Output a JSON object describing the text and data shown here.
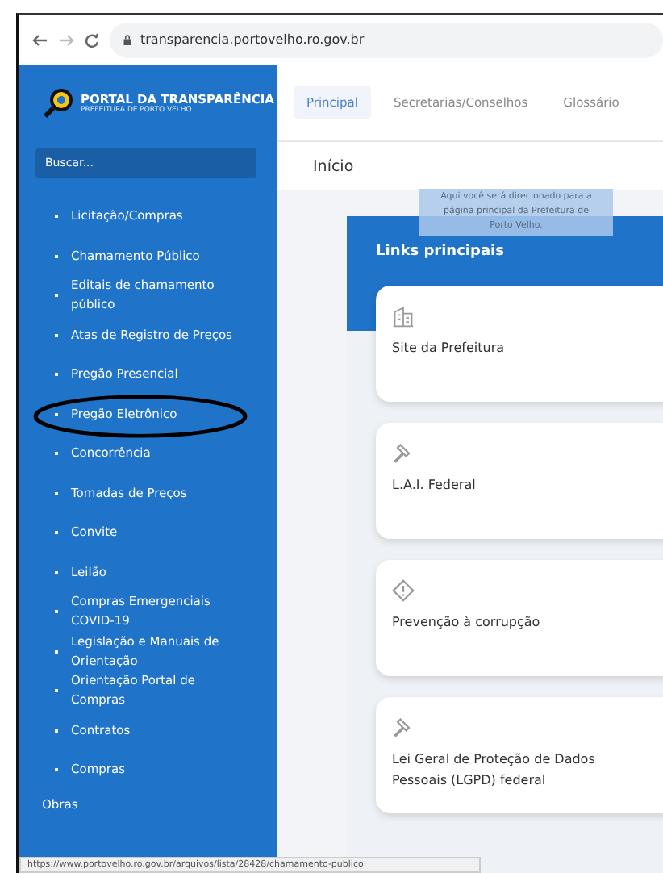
{
  "browser": {
    "url": "transparencia.portovelho.ro.gov.br"
  },
  "brand": {
    "title": "PORTAL DA TRANSPARÊNCIA",
    "subtitle": "PREFEITURA DE PORTO VELHO"
  },
  "search": {
    "placeholder": "Buscar..."
  },
  "sidebar": {
    "items": [
      {
        "label": "Licitação/Compras",
        "circled": false
      },
      {
        "label": "Chamamento Público",
        "circled": false
      },
      {
        "label": "Editais de chamamento público",
        "circled": false
      },
      {
        "label": "Atas de Registro de Preços",
        "circled": false
      },
      {
        "label": "Pregão Presencial",
        "circled": false
      },
      {
        "label": "Pregão Eletrônico",
        "circled": true
      },
      {
        "label": "Concorrência",
        "circled": false
      },
      {
        "label": "Tomadas de Preços",
        "circled": false
      },
      {
        "label": "Convite",
        "circled": false
      },
      {
        "label": "Leilão",
        "circled": false
      },
      {
        "label": "Compras Emergenciais COVID-19",
        "circled": false
      },
      {
        "label": "Legislação e Manuais de Orientação",
        "circled": false
      },
      {
        "label": "Orientação Portal de Compras",
        "circled": false
      },
      {
        "label": "Contratos",
        "circled": false
      },
      {
        "label": "Compras",
        "circled": false
      }
    ],
    "section": "Obras"
  },
  "tabs": [
    {
      "label": "Principal",
      "selected": true
    },
    {
      "label": "Secretarias/Conselhos",
      "selected": false
    },
    {
      "label": "Glossário",
      "selected": false
    }
  ],
  "page_title": "Início",
  "links": {
    "title": "Links principais",
    "tooltip": "Aqui você será direcionado para a página principal da Prefeitura de Porto Velho.",
    "cards": [
      {
        "kind": "building",
        "label": "Site da Prefeitura"
      },
      {
        "kind": "gavel",
        "label": "L.A.I. Federal"
      },
      {
        "kind": "warning",
        "label": "Prevenção à corrupção"
      },
      {
        "kind": "gavel",
        "label": "Lei Geral de Proteção de Dados Pessoais (LGPD) federal"
      }
    ]
  },
  "status_bar": "https://www.portovelho.ro.gov.br/arquivos/lista/28428/chamamento-publico"
}
